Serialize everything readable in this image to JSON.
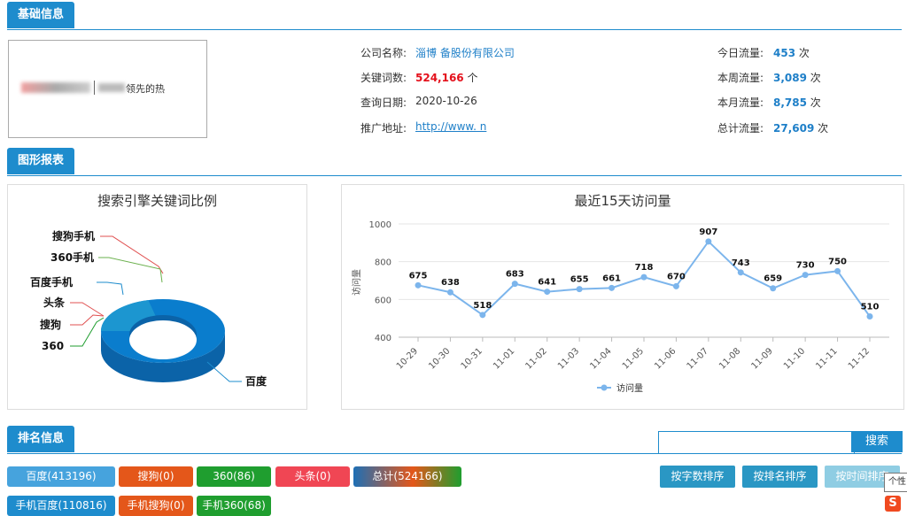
{
  "sections": {
    "basic": "基础信息",
    "charts": "图形报表",
    "ranking": "排名信息"
  },
  "logo": {
    "text": "领先的热"
  },
  "company": {
    "name_label": "公司名称:",
    "name_value": "淄博            备股份有限公司",
    "keywords_label": "关键词数:",
    "keywords_value": "524,166",
    "keywords_unit": "个",
    "date_label": "查询日期:",
    "date_value": "2020-10-26",
    "url_label": "推广地址:",
    "url_value": "http://www.         n"
  },
  "traffic": {
    "today_label": "今日流量:",
    "today_value": "453",
    "week_label": "本周流量:",
    "week_value": "3,089",
    "month_label": "本月流量:",
    "month_value": "8,785",
    "total_label": "总计流量:",
    "total_value": "27,609",
    "unit": "次"
  },
  "pie_title": "搜索引擎关键词比例",
  "line_title": "最近15天访问量",
  "chart_data": [
    {
      "type": "pie",
      "title": "搜索引擎关键词比例",
      "labels": [
        "百度",
        "搜狗手机",
        "360手机",
        "百度手机",
        "头条",
        "搜狗",
        "360"
      ],
      "values": [
        413196,
        0,
        68,
        110816,
        0,
        0,
        86
      ]
    },
    {
      "type": "line",
      "title": "最近15天访问量",
      "ylabel": "访问量",
      "x": [
        "10-29",
        "10-30",
        "10-31",
        "11-01",
        "11-02",
        "11-03",
        "11-04",
        "11-05",
        "11-06",
        "11-07",
        "11-08",
        "11-09",
        "11-10",
        "11-11",
        "11-12"
      ],
      "series": [
        {
          "name": "访问量",
          "values": [
            675,
            638,
            518,
            683,
            641,
            655,
            661,
            718,
            670,
            907,
            743,
            659,
            730,
            750,
            510
          ]
        }
      ],
      "ylim": [
        400,
        1000
      ],
      "yticks": [
        400,
        600,
        800,
        1000
      ],
      "legend": "bottom-center",
      "color": "#7cb5ec"
    }
  ],
  "search": {
    "button": "搜索",
    "placeholder": ""
  },
  "tags": {
    "baidu": "百度(413196)",
    "sogou": "搜狗(0)",
    "s360": "360(86)",
    "toutiao": "头条(0)",
    "total": "总计(524166)",
    "baidu_mobile": "手机百度(110816)",
    "sogou_mobile": "手机搜狗(0)",
    "s360_mobile": "手机360(68)"
  },
  "sort": {
    "by_chars": "按字数排序",
    "by_rank": "按排名排序",
    "by_time": "按时间排序"
  },
  "tooltip": "个性",
  "colors": {
    "primary": "#1e8ccd",
    "baidu": "#46a3dd",
    "sogou": "#e4571a",
    "s360": "#1f9e2f",
    "toutiao": "#f04654",
    "sort_btn": "#2a97c4",
    "sort_btn_light": "#8fcde3"
  }
}
